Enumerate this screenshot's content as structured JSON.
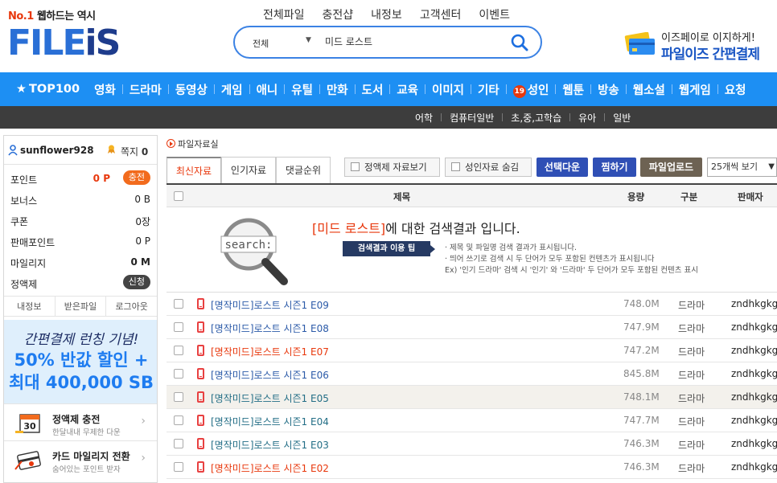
{
  "header": {
    "tagline_no1": "No.1",
    "tagline_rest": "웹하드는 역시",
    "logo_left": "FILE",
    "logo_right": "iS",
    "top_nav": [
      "전체파일",
      "충전샵",
      "내정보",
      "고객센터",
      "이벤트"
    ],
    "search": {
      "category": "전체",
      "query": "미드 로스트"
    },
    "promo": {
      "line1": "이즈페이로 이지하게!",
      "line2": "파일이즈 간편결제"
    }
  },
  "category_nav": {
    "top": "TOP100",
    "items": [
      "영화",
      "드라마",
      "동영상",
      "게임",
      "애니",
      "유틸",
      "만화",
      "도서",
      "교육",
      "이미지",
      "기타",
      "성인",
      "웹툰",
      "방송",
      "웹소설",
      "웹게임",
      "요청"
    ],
    "adult_badge": "19"
  },
  "sub_nav": [
    "어학",
    "컴퓨터일반",
    "초,중,고학습",
    "유아",
    "일반"
  ],
  "sidebar": {
    "username": "sunflower928",
    "note_label": "쪽지",
    "note_count": "0",
    "stats": [
      {
        "label": "포인트",
        "value": "0 P",
        "button": "충전"
      },
      {
        "label": "보너스",
        "value": "0 B"
      },
      {
        "label": "쿠폰",
        "value": "0장"
      },
      {
        "label": "판매포인트",
        "value": "0 P"
      },
      {
        "label": "마일리지",
        "value": "0 M"
      },
      {
        "label": "정액제",
        "button": "신청"
      }
    ],
    "tabs": [
      "내정보",
      "받은파일",
      "로그아웃"
    ],
    "banner": {
      "line1": "간편결제 런칭 기념!",
      "line2": "50% 반값 할인 +",
      "line3": "최대 400,000 SB"
    },
    "boxes": [
      {
        "title": "정액제 충전",
        "sub": "한달내내 무제한 다운",
        "icon_text": "30"
      },
      {
        "title": "카드 마일리지 전환",
        "sub": "숨어있는 포인트 받자"
      }
    ]
  },
  "main": {
    "breadcrumb": "파일자료실",
    "tabs": [
      "최신자료",
      "인기자료",
      "댓글순위"
    ],
    "options": [
      "정액제 자료보기",
      "성인자료 숨김"
    ],
    "actions": [
      "선택다운",
      "찜하기",
      "파일업로드"
    ],
    "per_page": "25개씩 보기",
    "columns": {
      "title": "제목",
      "size": "용량",
      "genre": "구분",
      "seller": "판매자"
    },
    "notice": {
      "search_badge": "search:",
      "keyword": "[미드 로스트]",
      "heading_rest": "에 대한 검색결과 입니다.",
      "tip_label": "검색결과 이용 팁",
      "line1": "· 제목 및 파일명 검색 결과가 표시됩니다.",
      "line2": "· 띄어 쓰기로 검색 시 두 단어가 모두 포함된 컨텐츠가 표시됩니다",
      "line3": "Ex) '인기 드라마' 검색 시 '인기' 와 '드라마' 두 단어가 모두 포함된 컨텐츠 표시"
    },
    "rows": [
      {
        "title": "[명작미드]로스트 시즌1 E09",
        "size": "748.0M",
        "genre": "드라마",
        "seller": "zndhkgkgk"
      },
      {
        "title": "[명작미드]로스트 시즌1 E08",
        "size": "747.9M",
        "genre": "드라마",
        "seller": "zndhkgkgk"
      },
      {
        "title": "[명작미드]로스트 시즌1 E07",
        "size": "747.2M",
        "genre": "드라마",
        "seller": "zndhkgkgk"
      },
      {
        "title": "[명작미드]로스트 시즌1 E06",
        "size": "845.8M",
        "genre": "드라마",
        "seller": "zndhkgkgk"
      },
      {
        "title": "[명작미드]로스트 시즌1 E05",
        "size": "748.1M",
        "genre": "드라마",
        "seller": "zndhkgkgk"
      },
      {
        "title": "[명작미드]로스트 시즌1 E04",
        "size": "747.7M",
        "genre": "드라마",
        "seller": "zndhkgkgk"
      },
      {
        "title": "[명작미드]로스트 시즌1 E03",
        "size": "746.3M",
        "genre": "드라마",
        "seller": "zndhkgkgk"
      },
      {
        "title": "[명작미드]로스트 시즌1 E02",
        "size": "746.3M",
        "genre": "드라마",
        "seller": "zndhkgkgk"
      }
    ]
  },
  "colors": {
    "brand_blue": "#1d8ff3",
    "accent_red": "#e8380d",
    "navy": "#263a63"
  }
}
